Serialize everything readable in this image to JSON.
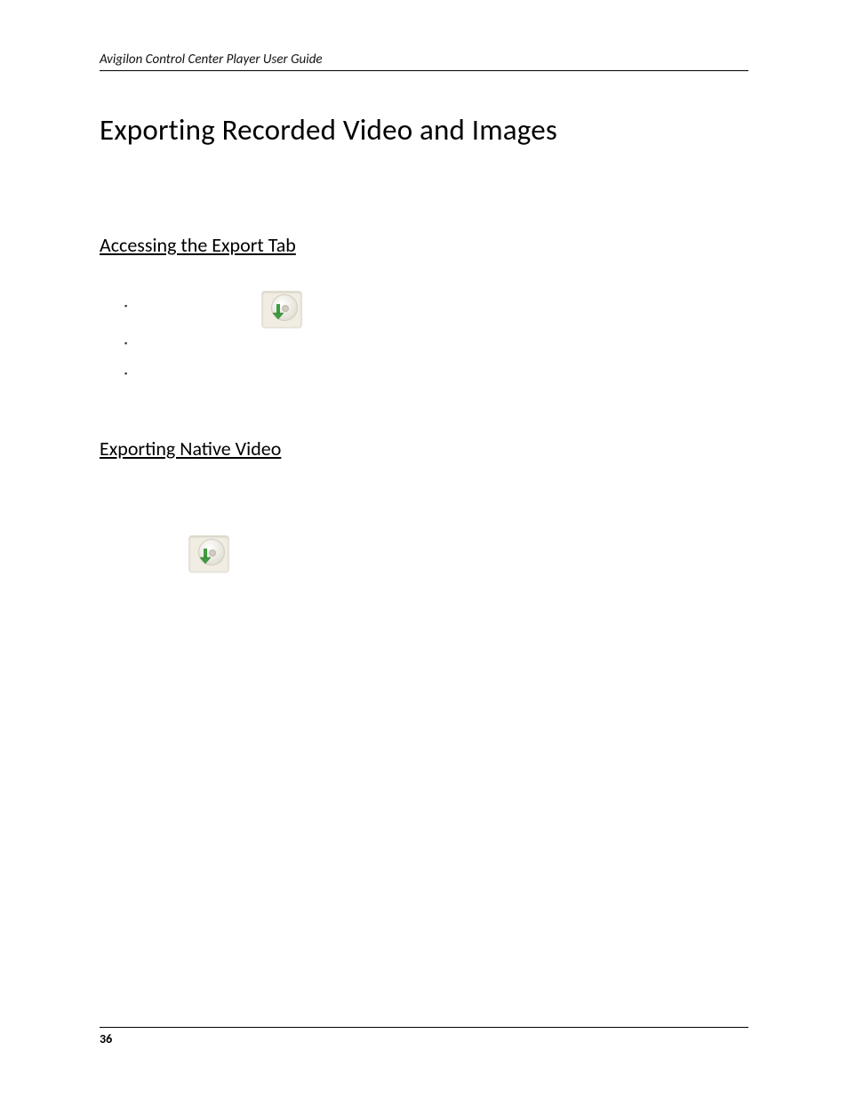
{
  "header": {
    "running_title": "Avigilon Control Center Player User Guide"
  },
  "headings": {
    "h1": "Exporting Recorded Video and Images",
    "h2_a": "Accessing the Export Tab",
    "h2_b": "Exporting Native Video"
  },
  "icons": {
    "export_icon_name": "export-disc-arrow-icon"
  },
  "footer": {
    "page_number": "36"
  }
}
